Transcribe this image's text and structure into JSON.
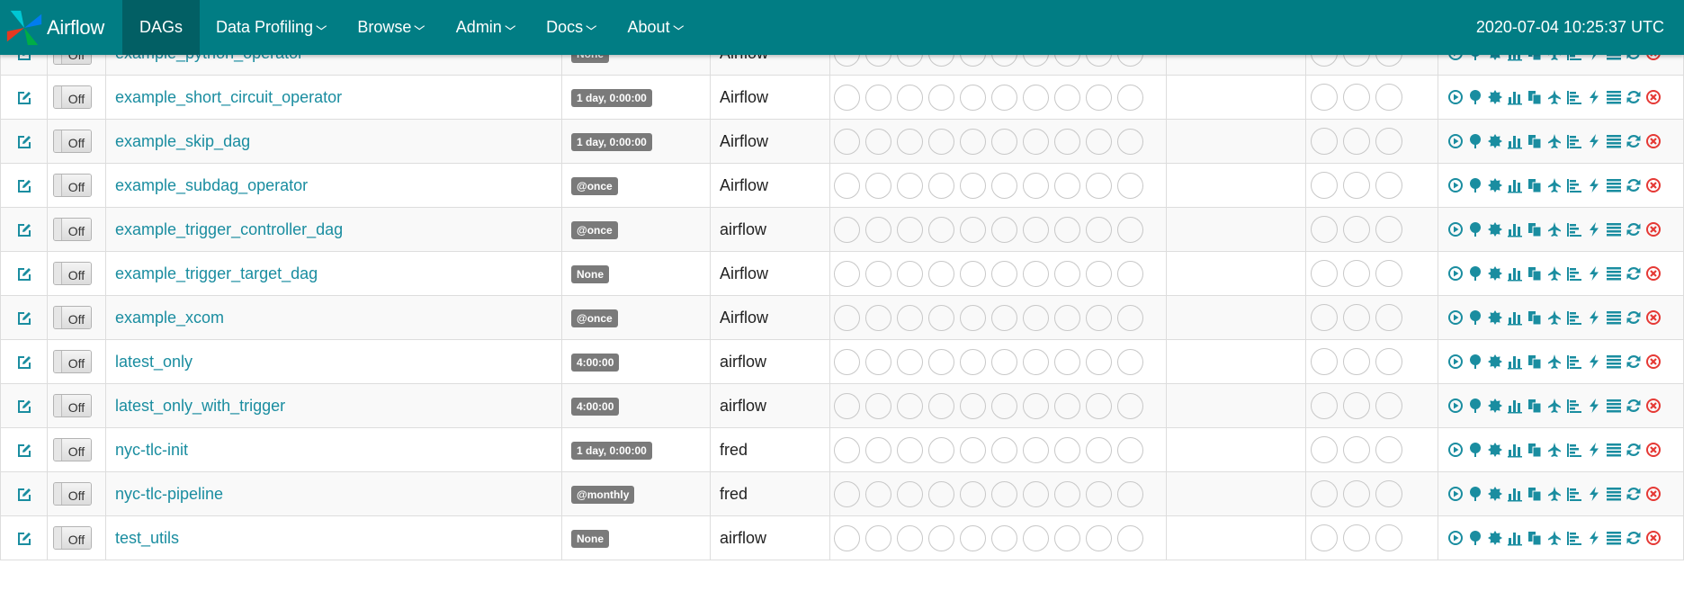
{
  "navbar": {
    "brand": "Airflow",
    "items": [
      {
        "label": "DAGs",
        "active": true,
        "caret": false
      },
      {
        "label": "Data Profiling",
        "active": false,
        "caret": true
      },
      {
        "label": "Browse",
        "active": false,
        "caret": true
      },
      {
        "label": "Admin",
        "active": false,
        "caret": true
      },
      {
        "label": "Docs",
        "active": false,
        "caret": true
      },
      {
        "label": "About",
        "active": false,
        "caret": true
      }
    ],
    "clock": "2020-07-04 10:25:37 UTC"
  },
  "colors": {
    "navbar": "#017d84",
    "navbar_active": "#025f64",
    "link": "#1a8da0",
    "icon": "#1a8da0",
    "delete": "#e53935",
    "label": "#7a7a7a"
  },
  "rows": [
    {
      "name": "example_python_operator",
      "schedule": "None",
      "owner": "Airflow",
      "toggle": "Off"
    },
    {
      "name": "example_short_circuit_operator",
      "schedule": "1 day, 0:00:00",
      "owner": "Airflow",
      "toggle": "Off"
    },
    {
      "name": "example_skip_dag",
      "schedule": "1 day, 0:00:00",
      "owner": "Airflow",
      "toggle": "Off"
    },
    {
      "name": "example_subdag_operator",
      "schedule": "@once",
      "owner": "Airflow",
      "toggle": "Off"
    },
    {
      "name": "example_trigger_controller_dag",
      "schedule": "@once",
      "owner": "airflow",
      "toggle": "Off"
    },
    {
      "name": "example_trigger_target_dag",
      "schedule": "None",
      "owner": "Airflow",
      "toggle": "Off"
    },
    {
      "name": "example_xcom",
      "schedule": "@once",
      "owner": "Airflow",
      "toggle": "Off"
    },
    {
      "name": "latest_only",
      "schedule": "4:00:00",
      "owner": "airflow",
      "toggle": "Off"
    },
    {
      "name": "latest_only_with_trigger",
      "schedule": "4:00:00",
      "owner": "airflow",
      "toggle": "Off"
    },
    {
      "name": "nyc-tlc-init",
      "schedule": "1 day, 0:00:00",
      "owner": "fred",
      "toggle": "Off"
    },
    {
      "name": "nyc-tlc-pipeline",
      "schedule": "@monthly",
      "owner": "fred",
      "toggle": "Off"
    },
    {
      "name": "test_utils",
      "schedule": "None",
      "owner": "airflow",
      "toggle": "Off"
    }
  ],
  "recent_task_circles": 10,
  "dag_run_circles": 3,
  "link_icons": [
    "trigger-dag-icon",
    "tree-view-icon",
    "graph-view-icon",
    "duration-icon",
    "task-tries-icon",
    "landing-times-icon",
    "gantt-icon",
    "code-icon",
    "logs-icon",
    "refresh-icon",
    "delete-icon"
  ]
}
